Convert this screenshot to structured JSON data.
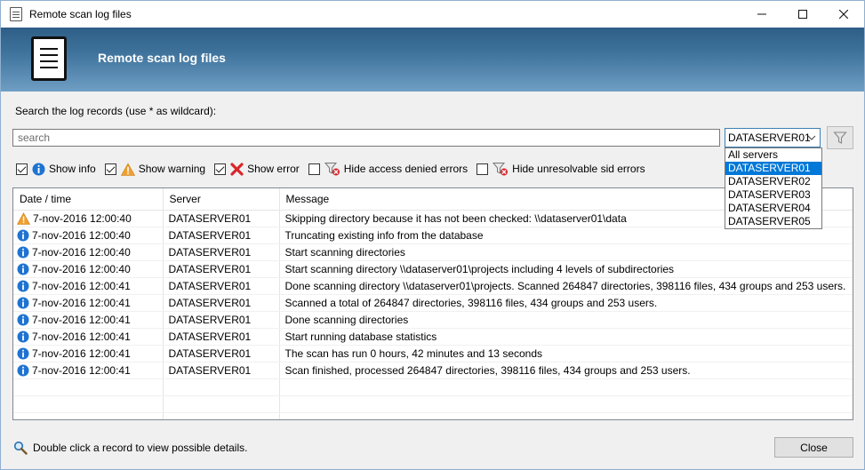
{
  "window": {
    "title": "Remote scan log files",
    "controls": {
      "minimize": "—",
      "maximize": "☐",
      "close": "✕"
    }
  },
  "banner": {
    "title": "Remote scan log files"
  },
  "search": {
    "label": "Search the log records (use * as wildcard):",
    "placeholder": "search",
    "value": ""
  },
  "server_select": {
    "selected": "DATASERVER01",
    "options": [
      "All servers",
      "DATASERVER01",
      "DATASERVER02",
      "DATASERVER03",
      "DATASERVER04",
      "DATASERVER05"
    ]
  },
  "filters": {
    "show_info": {
      "label": "Show info",
      "checked": true
    },
    "show_warning": {
      "label": "Show warning",
      "checked": true
    },
    "show_error": {
      "label": "Show error",
      "checked": true
    },
    "hide_access_denied": {
      "label": "Hide access denied errors",
      "checked": false
    },
    "hide_unresolvable_sid": {
      "label": "Hide unresolvable sid errors",
      "checked": false
    }
  },
  "grid": {
    "columns": [
      "Date / time",
      "Server",
      "Message"
    ],
    "rows": [
      {
        "type": "warning-icon",
        "date": "7-nov-2016 12:00:40",
        "server": "DATASERVER01",
        "message": "Skipping directory because it has not been checked: \\\\dataserver01\\data"
      },
      {
        "type": "info-icon",
        "date": "7-nov-2016 12:00:40",
        "server": "DATASERVER01",
        "message": "Truncating existing info from the database"
      },
      {
        "type": "info-icon",
        "date": "7-nov-2016 12:00:40",
        "server": "DATASERVER01",
        "message": "Start scanning directories"
      },
      {
        "type": "info-icon",
        "date": "7-nov-2016 12:00:40",
        "server": "DATASERVER01",
        "message": "Start scanning directory \\\\dataserver01\\projects including 4 levels of subdirectories"
      },
      {
        "type": "info-icon",
        "date": "7-nov-2016 12:00:41",
        "server": "DATASERVER01",
        "message": "Done scanning directory \\\\dataserver01\\projects. Scanned 264847 directories, 398116 files, 434 groups and 253 users."
      },
      {
        "type": "info-icon",
        "date": "7-nov-2016 12:00:41",
        "server": "DATASERVER01",
        "message": "Scanned a total of 264847 directories, 398116 files, 434 groups and 253 users."
      },
      {
        "type": "info-icon",
        "date": "7-nov-2016 12:00:41",
        "server": "DATASERVER01",
        "message": "Done scanning directories"
      },
      {
        "type": "info-icon",
        "date": "7-nov-2016 12:00:41",
        "server": "DATASERVER01",
        "message": "Start running database statistics"
      },
      {
        "type": "info-icon",
        "date": "7-nov-2016 12:00:41",
        "server": "DATASERVER01",
        "message": "The scan has run 0 hours, 42 minutes and 13 seconds"
      },
      {
        "type": "info-icon",
        "date": "7-nov-2016 12:00:41",
        "server": "DATASERVER01",
        "message": "Scan finished, processed 264847 directories, 398116 files, 434 groups and 253 users."
      }
    ]
  },
  "footer": {
    "hint": "Double click a record to view possible details.",
    "close_label": "Close"
  },
  "colors": {
    "banner_top": "#2e5e86",
    "banner_bottom": "#6f9ec4",
    "selection": "#0078d7",
    "info": "#1e73d2",
    "warning": "#f0a030",
    "error": "#d8262b"
  }
}
